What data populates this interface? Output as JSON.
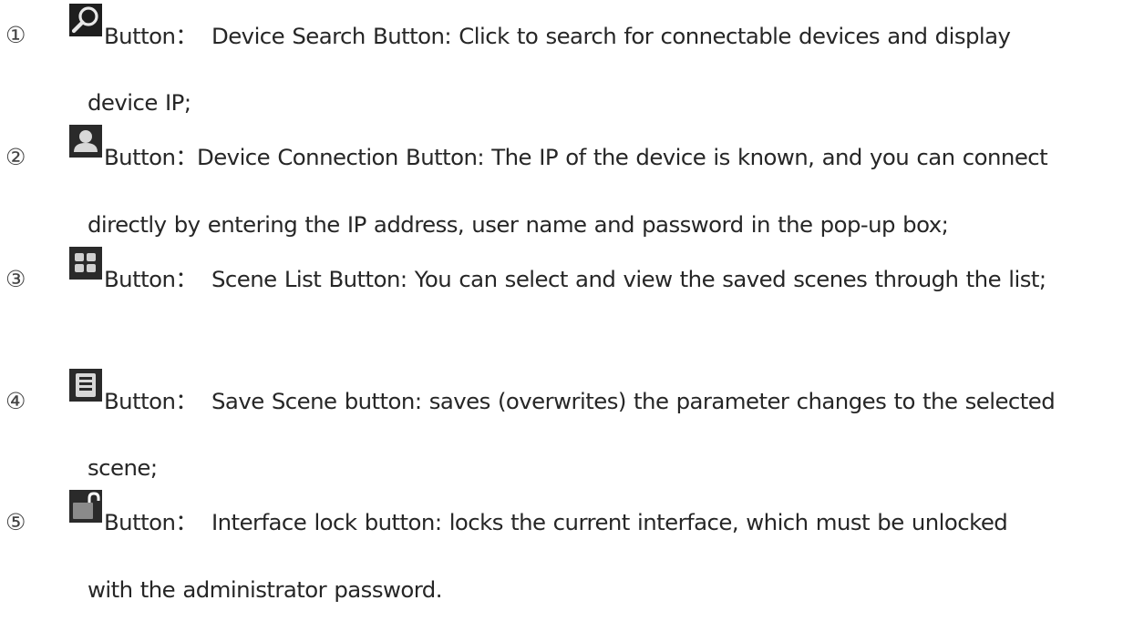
{
  "items": [
    {
      "number": "①",
      "icon": "search-icon",
      "button_word": "Button：",
      "line1": "Device Search Button: Click to search for connectable devices and display",
      "line2": "device IP;"
    },
    {
      "number": "②",
      "icon": "user-icon",
      "button_word": "Button：",
      "line1": "Device Connection Button: The IP of the device is known, and you can connect",
      "line2": "directly by entering the IP address, user name and password in the pop-up box;"
    },
    {
      "number": "③",
      "icon": "grid-icon",
      "button_word": "Button：",
      "line1": "Scene List Button: You can select and view the saved scenes through the list;",
      "line2": ""
    },
    {
      "number": "④",
      "icon": "save-icon",
      "button_word": "Button：",
      "line1": "Save Scene button: saves (overwrites) the parameter changes to the selected",
      "line2": "scene;"
    },
    {
      "number": "⑤",
      "icon": "unlock-icon",
      "button_word": "Button：",
      "line1": "Interface lock button: locks the current interface, which must be unlocked",
      "line2": "with the administrator password."
    }
  ]
}
